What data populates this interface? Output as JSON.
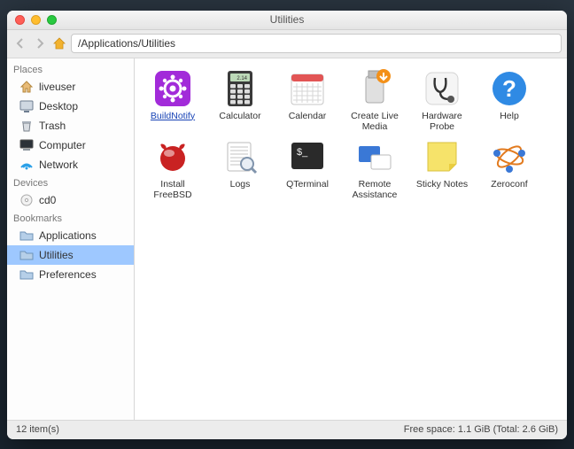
{
  "window": {
    "title": "Utilities"
  },
  "toolbar": {
    "path": "/Applications/Utilities"
  },
  "sidebar": {
    "sections": [
      {
        "header": "Places",
        "items": [
          {
            "id": "liveuser",
            "label": "liveuser",
            "icon": "home"
          },
          {
            "id": "desktop",
            "label": "Desktop",
            "icon": "desktop"
          },
          {
            "id": "trash",
            "label": "Trash",
            "icon": "trash"
          },
          {
            "id": "computer",
            "label": "Computer",
            "icon": "computer"
          },
          {
            "id": "network",
            "label": "Network",
            "icon": "network"
          }
        ]
      },
      {
        "header": "Devices",
        "items": [
          {
            "id": "cd0",
            "label": "cd0",
            "icon": "disc"
          }
        ]
      },
      {
        "header": "Bookmarks",
        "items": [
          {
            "id": "applications",
            "label": "Applications",
            "icon": "folder"
          },
          {
            "id": "utilities",
            "label": "Utilities",
            "icon": "folder",
            "selected": true
          },
          {
            "id": "preferences",
            "label": "Preferences",
            "icon": "folder"
          }
        ]
      }
    ]
  },
  "items": [
    {
      "id": "buildnotify",
      "label": "BuildNotify",
      "icon": "gear-purple",
      "selected": true
    },
    {
      "id": "calculator",
      "label": "Calculator",
      "icon": "calculator"
    },
    {
      "id": "calendar",
      "label": "Calendar",
      "icon": "calendar"
    },
    {
      "id": "create-live-media",
      "label": "Create Live Media",
      "icon": "usb-orange"
    },
    {
      "id": "hardware-probe",
      "label": "Hardware Probe",
      "icon": "stethoscope"
    },
    {
      "id": "help",
      "label": "Help",
      "icon": "help"
    },
    {
      "id": "install-freebsd",
      "label": "Install FreeBSD",
      "icon": "freebsd"
    },
    {
      "id": "logs",
      "label": "Logs",
      "icon": "logs"
    },
    {
      "id": "qterminal",
      "label": "QTerminal",
      "icon": "terminal"
    },
    {
      "id": "remote-assistance",
      "label": "Remote Assistance",
      "icon": "remote"
    },
    {
      "id": "sticky-notes",
      "label": "Sticky Notes",
      "icon": "sticky"
    },
    {
      "id": "zeroconf",
      "label": "Zeroconf",
      "icon": "zeroconf"
    }
  ],
  "status": {
    "left": "12 item(s)",
    "right": "Free space: 1.1 GiB (Total: 2.6 GiB)"
  }
}
